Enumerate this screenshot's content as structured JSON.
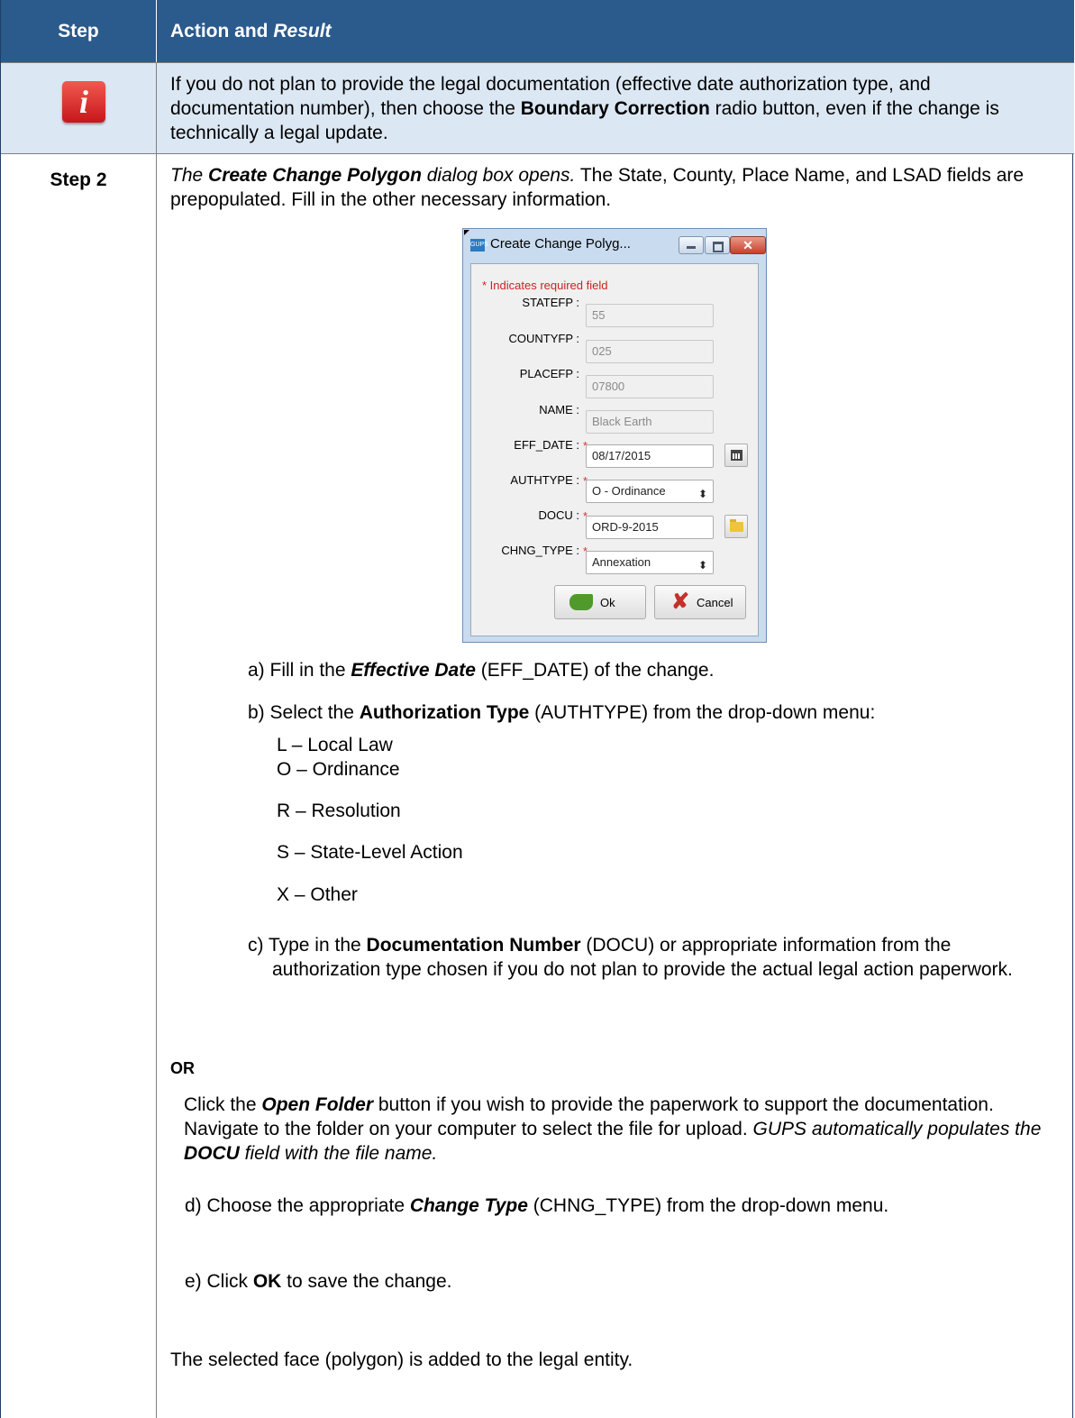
{
  "header": {
    "step_label": "Step",
    "action_label": "Action and ",
    "result_label": "Result"
  },
  "note": {
    "icon": "info-icon",
    "text_1": "If you do not plan to provide the legal documentation (effective date authorization type, and documentation number), then choose the ",
    "text_bold": "Boundary Correction",
    "text_2": " radio button, even if the change is technically a legal update."
  },
  "step2": {
    "label": "Step 2",
    "intro_it_1": "The ",
    "intro_bi": "Create Change Polygon",
    "intro_it_2": " dialog box opens.",
    "intro_rest": " The State, County, Place Name, and LSAD fields are prepopulated. Fill in the other necessary information.",
    "a_1": "a) Fill in the ",
    "a_bi": "Effective Date",
    "a_2": " (EFF_DATE) of the change.",
    "b_1": "b) Select the ",
    "b_bold": "Authorization Type",
    "b_2": " (AUTHTYPE) from the drop-down menu:",
    "auth_types": [
      "L – Local Law",
      "O – Ordinance",
      "R – Resolution",
      "S – State-Level Action",
      "X – Other"
    ],
    "c_1": "c)  Type in the ",
    "c_bold": "Documentation Number",
    "c_2": " (DOCU) or appropriate information from the authorization type chosen if you do not plan to provide the actual legal action paperwork.",
    "or": "OR",
    "folder_1": "Click the ",
    "folder_bi": "Open Folder",
    "folder_2": " button if you wish to provide the paperwork to support the documentation. Navigate to the folder on your computer to select the file for upload. ",
    "folder_it_1": "GUPS automatically populates the ",
    "folder_bi_2": "DOCU",
    "folder_it_2": " field with the file name.",
    "d_1": "d) Choose the appropriate ",
    "d_bi": "Change Type",
    "d_2": " (CHNG_TYPE) from the drop-down menu.",
    "e_1": "e) Click ",
    "e_bold": "OK",
    "e_2": " to save the change.",
    "final": "The selected face (polygon) is added to the legal entity."
  },
  "dialog": {
    "app_badge": "GUPS",
    "title": "Create Change Polyg...",
    "close_glyph": "✕",
    "required_note": "* Indicates required field",
    "required_star": "*",
    "fields": {
      "statefp": {
        "label": "STATEFP :",
        "value": "55"
      },
      "countyfp": {
        "label": "COUNTYFP :",
        "value": "025"
      },
      "placefp": {
        "label": "PLACEFP :",
        "value": "07800"
      },
      "name": {
        "label": "NAME :",
        "value": "Black Earth"
      },
      "eff_date": {
        "label": "EFF_DATE :",
        "value": "08/17/2015"
      },
      "authtype": {
        "label": "AUTHTYPE :",
        "value": "O - Ordinance"
      },
      "docu": {
        "label": "DOCU :",
        "value": "ORD-9-2015"
      },
      "chng_type": {
        "label": "CHNG_TYPE :",
        "value": "Annexation"
      }
    },
    "ok_label": "Ok",
    "cancel_label": "Cancel",
    "spinner_glyph": "⬍",
    "cancel_glyph": "✘"
  }
}
